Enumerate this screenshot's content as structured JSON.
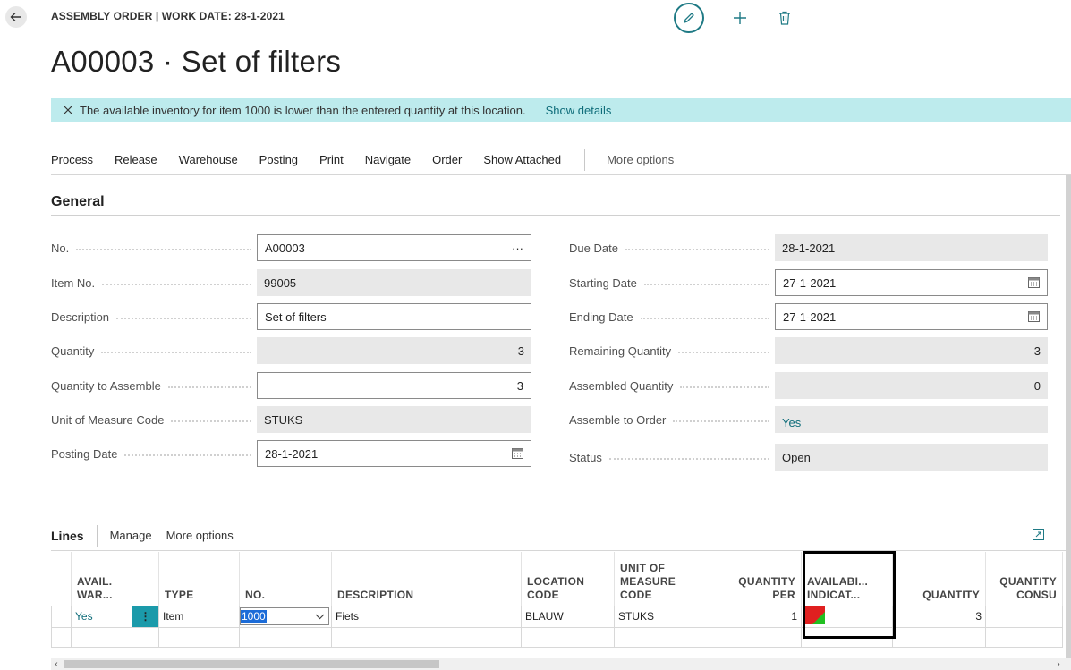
{
  "header": {
    "caption": "ASSEMBLY ORDER | WORK DATE: 28-1-2021",
    "title": "A00003 · Set of filters"
  },
  "notification": {
    "message": "The available inventory for item 1000 is lower than the entered quantity at this location.",
    "link": "Show details"
  },
  "actions": [
    "Process",
    "Release",
    "Warehouse",
    "Posting",
    "Print",
    "Navigate",
    "Order",
    "Show Attached"
  ],
  "actions_more": "More options",
  "general": {
    "title": "General",
    "left": [
      {
        "label": "No.",
        "value": "A00003"
      },
      {
        "label": "Item No.",
        "value": "99005"
      },
      {
        "label": "Description",
        "value": "Set of filters"
      },
      {
        "label": "Quantity",
        "value": "3"
      },
      {
        "label": "Quantity to Assemble",
        "value": "3"
      },
      {
        "label": "Unit of Measure Code",
        "value": "STUKS"
      },
      {
        "label": "Posting Date",
        "value": "28-1-2021"
      }
    ],
    "right": [
      {
        "label": "Due Date",
        "value": "28-1-2021"
      },
      {
        "label": "Starting Date",
        "value": "27-1-2021"
      },
      {
        "label": "Ending Date",
        "value": "27-1-2021"
      },
      {
        "label": "Remaining Quantity",
        "value": "3"
      },
      {
        "label": "Assembled Quantity",
        "value": "0"
      },
      {
        "label": "Assemble to Order",
        "value": "Yes"
      },
      {
        "label": "Status",
        "value": "Open"
      }
    ],
    "more_icon": "···"
  },
  "lines": {
    "title": "Lines",
    "manage": "Manage",
    "more": "More options",
    "columns": {
      "avail": [
        "AVAIL.",
        "WAR..."
      ],
      "type": "TYPE",
      "no": "NO.",
      "description": "DESCRIPTION",
      "location": [
        "LOCATION",
        "CODE"
      ],
      "uom": [
        "UNIT OF",
        "MEASURE",
        "CODE"
      ],
      "qty_per": [
        "QUANTITY",
        "PER"
      ],
      "availability": [
        "AVAILABI...",
        "INDICAT..."
      ],
      "quantity": "QUANTITY",
      "qty_cons": [
        "QUANTITY",
        "CONSU"
      ]
    },
    "row": {
      "avail": "Yes",
      "type": "Item",
      "no": "1000",
      "description": "Fiets",
      "location": "BLAUW",
      "uom": "STUKS",
      "qty_per": "1",
      "quantity": "3"
    },
    "add_row_symbol": "+"
  },
  "colors": {
    "accent": "#0f6d7a",
    "notification_bg": "#bdebed",
    "indicator_red": "#e02020",
    "indicator_green": "#22c022"
  }
}
